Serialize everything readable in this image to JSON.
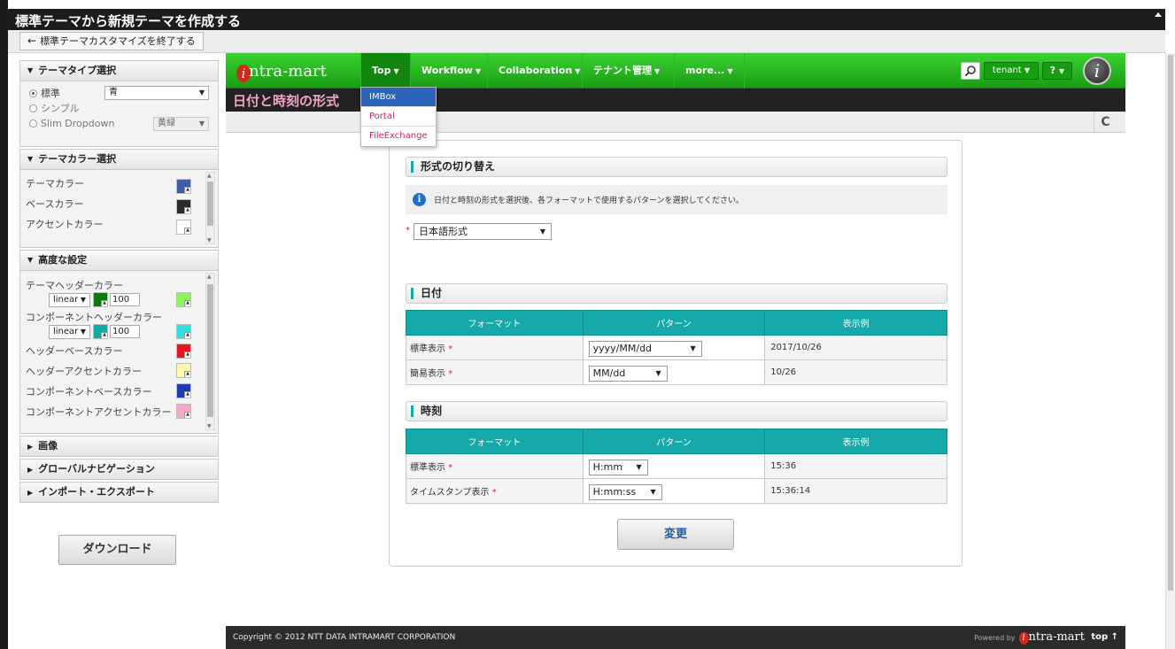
{
  "window": {
    "title": "標準テーマから新規テーマを作成する",
    "exit_button": "標準テーマカスタマイズを終了する"
  },
  "left_panel": {
    "theme_type": {
      "header": "テーマタイプ選択",
      "options": [
        {
          "label": "標準",
          "selected": true,
          "select_value": "青"
        },
        {
          "label": "シンプル",
          "selected": false
        },
        {
          "label": "Slim Dropdown",
          "selected": false,
          "select_value": "黄緑"
        }
      ]
    },
    "theme_color": {
      "header": "テーマカラー選択",
      "rows": [
        {
          "label": "テーマカラー",
          "color": "#3b5ea8"
        },
        {
          "label": "ベースカラー",
          "color": "#2a2a2a"
        },
        {
          "label": "アクセントカラー",
          "color": "#ffffff"
        }
      ]
    },
    "advanced": {
      "header": "高度な設定",
      "header_color": {
        "label": "テーマヘッダーカラー",
        "mode": "linear",
        "color": "#0a7a0a",
        "value": "100",
        "end_color": "#8cf55a"
      },
      "component_header_color": {
        "label": "コンポーネントヘッダーカラー",
        "mode": "linear",
        "color": "#12a9a9",
        "value": "100",
        "end_color": "#35dede"
      },
      "rows": [
        {
          "label": "ヘッダーベースカラー",
          "color": "#e8141e"
        },
        {
          "label": "ヘッダーアクセントカラー",
          "color": "#fff8a8"
        },
        {
          "label": "コンポーネントベースカラー",
          "color": "#1c3cb0"
        },
        {
          "label": "コンポーネントアクセントカラー",
          "color": "#f6a8cc"
        }
      ]
    },
    "collapsed_sections": [
      "画像",
      "グローバルナビゲーション",
      "インポート・エクスポート"
    ],
    "download_button": "ダウンロード"
  },
  "app": {
    "logo_text": "ntra-mart",
    "logo_mark": "i",
    "nav": [
      {
        "label": "Top",
        "active": true
      },
      {
        "label": "Workflow"
      },
      {
        "label": "Collaboration"
      },
      {
        "label": "テナント管理"
      },
      {
        "label": "more..."
      }
    ],
    "tenant_label": "tenant",
    "help_label": "?",
    "user_icon_mark": "i",
    "dropdown": [
      "IMBox",
      "Portal",
      "FileExchange"
    ],
    "page_title": "日付と時刻の形式",
    "refresh_glyph": "C"
  },
  "content": {
    "format_switch": {
      "header": "形式の切り替え",
      "info": "日付と時刻の形式を選択後、各フォーマットで使用するパターンを選択してください。",
      "required_mark": "*",
      "select_value": "日本語形式"
    },
    "date": {
      "header": "日付",
      "columns": [
        "フォーマット",
        "パターン",
        "表示例"
      ],
      "rows": [
        {
          "format": "標準表示",
          "pattern": "yyyy/MM/dd",
          "example": "2017/10/26"
        },
        {
          "format": "簡易表示",
          "pattern": "MM/dd",
          "example": "10/26"
        }
      ]
    },
    "time": {
      "header": "時刻",
      "columns": [
        "フォーマット",
        "パターン",
        "表示例"
      ],
      "rows": [
        {
          "format": "標準表示",
          "pattern": "H:mm",
          "example": "15:36"
        },
        {
          "format": "タイムスタンプ表示",
          "pattern": "H:mm:ss",
          "example": "15:36:14"
        }
      ]
    },
    "change_button": "変更"
  },
  "footer": {
    "copyright": "Copyright © 2012 NTT DATA INTRAMART CORPORATION",
    "powered_by": "Powered by",
    "brand": "ntra-mart",
    "brand_mark": "i",
    "top_link": "top ↑"
  }
}
